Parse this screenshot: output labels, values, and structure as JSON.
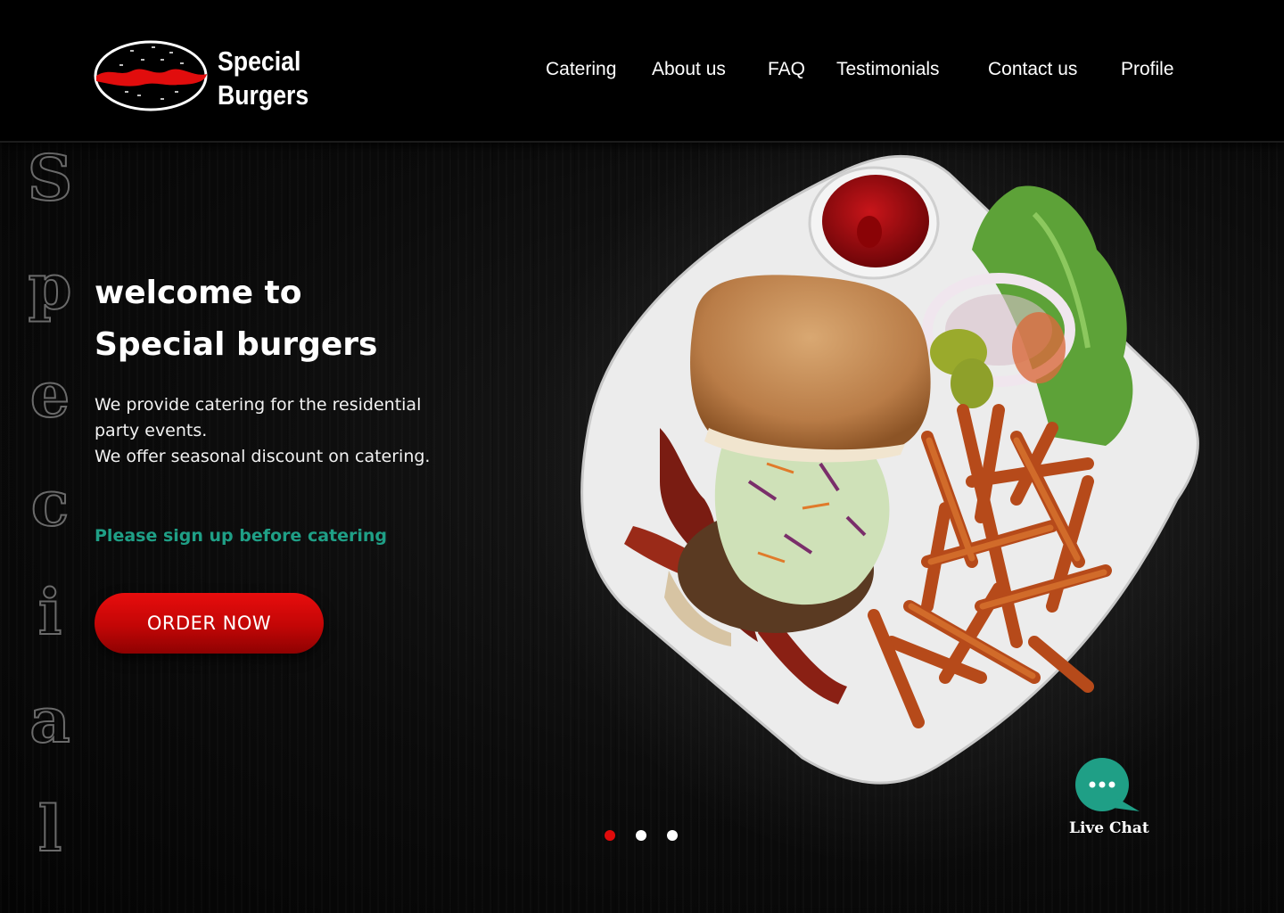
{
  "brand": {
    "line1": "Special",
    "line2": "Burgers"
  },
  "nav": {
    "items": [
      "Catering",
      "About us",
      "FAQ",
      "Testimonials",
      "Contact us",
      "Profile"
    ]
  },
  "side_word": [
    "S",
    "p",
    "e",
    "c",
    "i",
    "a",
    "l"
  ],
  "hero": {
    "title_line1": "welcome to",
    "title_line2": "Special burgers",
    "desc_line1": "We provide catering for the residential party events.",
    "desc_line2": "We offer seasonal discount on catering.",
    "signup_note": "Please sign up before catering",
    "order_button": "ORDER NOW"
  },
  "carousel": {
    "slides": 3,
    "active": 1
  },
  "chat": {
    "label": "Live Chat",
    "icon": "chat-bubble-icon"
  },
  "colors": {
    "accent_red": "#e00b0b",
    "accent_teal": "#1f9f86",
    "background": "#050505"
  }
}
